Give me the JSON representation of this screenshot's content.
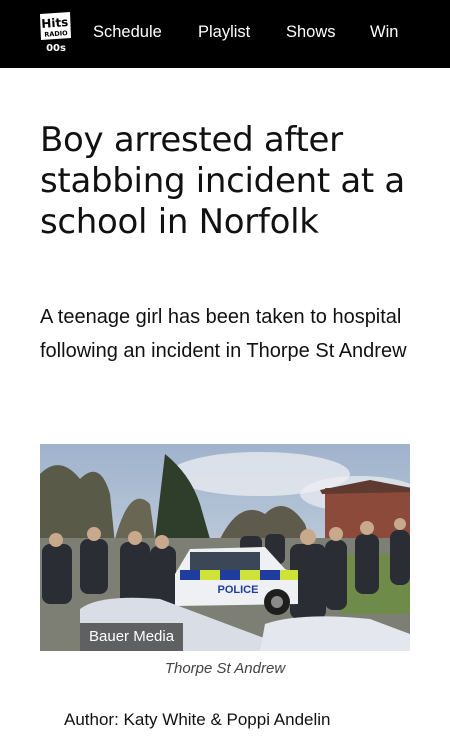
{
  "header": {
    "logo": {
      "text": "Hits Radio 00s",
      "icon": "hits-radio-00s-logo"
    },
    "nav": [
      {
        "label": "Schedule"
      },
      {
        "label": "Playlist"
      },
      {
        "label": "Shows"
      },
      {
        "label": "Win"
      }
    ]
  },
  "article": {
    "headline": "Boy arrested after stabbing incident at a school in Norfolk",
    "standfirst": "A teenage girl has been taken to hospital following an incident in Thorpe St Andrew",
    "image": {
      "credit": "Bauer Media",
      "caption": "Thorpe St Andrew",
      "police_car_text": "POLICE"
    },
    "author": "Author: Katy White & Poppi Andelin"
  },
  "colors": {
    "topbar": "#000000",
    "text": "#111111",
    "caption": "#444444"
  }
}
